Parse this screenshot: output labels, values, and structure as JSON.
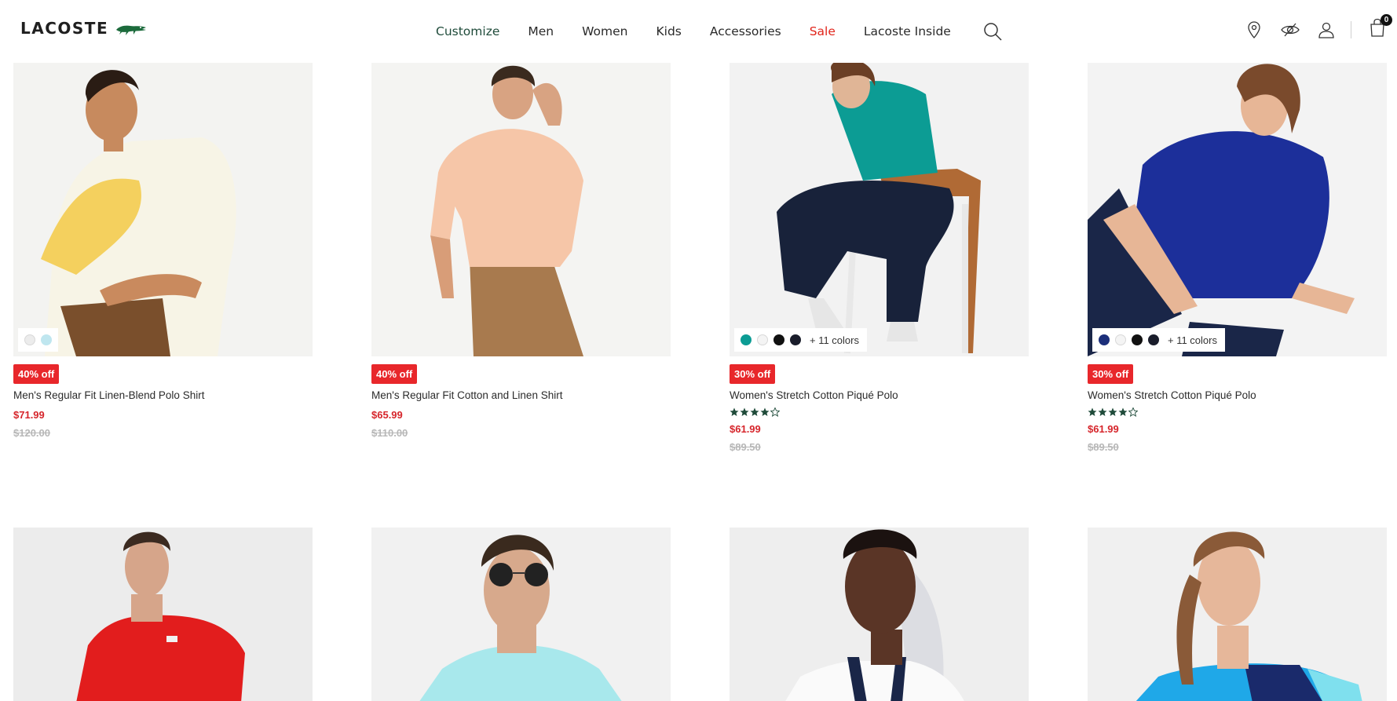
{
  "header": {
    "logo_text": "LACOSTE",
    "nav": [
      "Customize",
      "Men",
      "Women",
      "Kids",
      "Accessories",
      "Sale",
      "Lacoste Inside"
    ],
    "cart_count": "0"
  },
  "icons": {
    "search": "search-icon",
    "store": "location-pin-icon",
    "inside": "eye-icon",
    "account": "user-icon",
    "cart": "shopping-bag-icon"
  },
  "colors": {
    "sale": "#e1251b",
    "badge": "#e8272b",
    "price": "#d6252b",
    "rating": "#1f4b3a"
  },
  "products": [
    {
      "discount": "40% off",
      "title": "Men's Regular Fit Linen-Blend Polo Shirt",
      "price": "$71.99",
      "old_price": "$120.00",
      "swatches": [
        "#ececec",
        "#bfe6ef"
      ],
      "more_colors": "",
      "rating": 0
    },
    {
      "discount": "40% off",
      "title": "Men's Regular Fit Cotton and Linen Shirt",
      "price": "$65.99",
      "old_price": "$110.00",
      "swatches": [],
      "more_colors": "",
      "rating": 0
    },
    {
      "discount": "30% off",
      "title": "Women's Stretch Cotton Piqué Polo",
      "price": "$61.99",
      "old_price": "$89.50",
      "swatches": [
        "#0c9c94",
        "#f4f4f4",
        "#111111",
        "#1a1d2b"
      ],
      "more_colors": "+ 11 colors",
      "rating": 4
    },
    {
      "discount": "30% off",
      "title": "Women's Stretch Cotton Piqué Polo",
      "price": "$61.99",
      "old_price": "$89.50",
      "swatches": [
        "#1c2f7a",
        "#f4f4f4",
        "#111111",
        "#1a1d2b"
      ],
      "more_colors": "+ 11 colors",
      "rating": 4
    },
    {
      "discount": "",
      "title": "",
      "price": "",
      "old_price": "",
      "swatches": [],
      "more_colors": "",
      "rating": 0
    },
    {
      "discount": "",
      "title": "",
      "price": "",
      "old_price": "",
      "swatches": [],
      "more_colors": "",
      "rating": 0
    },
    {
      "discount": "",
      "title": "",
      "price": "",
      "old_price": "",
      "swatches": [],
      "more_colors": "",
      "rating": 0
    },
    {
      "discount": "",
      "title": "",
      "price": "",
      "old_price": "",
      "swatches": [],
      "more_colors": "",
      "rating": 0
    }
  ]
}
